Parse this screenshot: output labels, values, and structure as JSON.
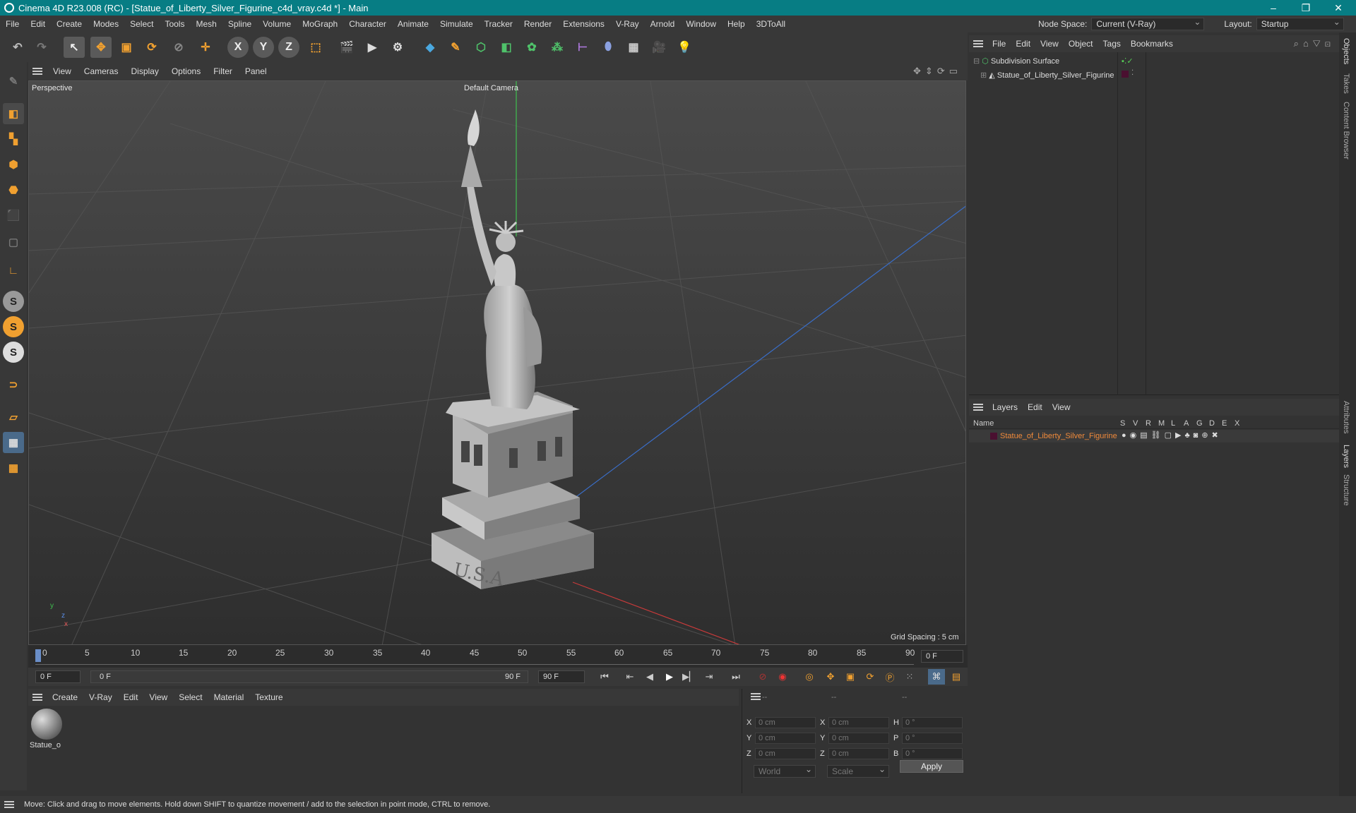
{
  "window": {
    "title": "Cinema 4D R23.008 (RC) - [Statue_of_Liberty_Silver_Figurine_c4d_vray.c4d *] - Main",
    "controls": [
      "–",
      "❐",
      "✕"
    ]
  },
  "menubar": {
    "items": [
      "File",
      "Edit",
      "Create",
      "Modes",
      "Select",
      "Tools",
      "Mesh",
      "Spline",
      "Volume",
      "MoGraph",
      "Character",
      "Animate",
      "Simulate",
      "Tracker",
      "Render",
      "Extensions",
      "V-Ray",
      "Arnold",
      "Window",
      "Help",
      "3DToAll"
    ],
    "node_space_label": "Node Space:",
    "node_space_value": "Current (V-Ray)",
    "layout_label": "Layout:",
    "layout_value": "Startup"
  },
  "toolbar": {
    "axis_x": "X",
    "axis_y": "Y",
    "axis_z": "Z"
  },
  "leftbar": {
    "s1": "S",
    "s2": "S",
    "s3": "S"
  },
  "viewport": {
    "menu": [
      "View",
      "Cameras",
      "Display",
      "Options",
      "Filter",
      "Panel"
    ],
    "label": "Perspective",
    "camera": "Default Camera",
    "grid_spacing": "Grid Spacing : 5 cm",
    "axis_y": "y",
    "axis_z": "z",
    "axis_x": "x"
  },
  "timeline": {
    "ticks": [
      "0",
      "5",
      "10",
      "15",
      "20",
      "25",
      "30",
      "35",
      "40",
      "45",
      "50",
      "55",
      "60",
      "65",
      "70",
      "75",
      "80",
      "85",
      "90"
    ],
    "current_frame": "0 F"
  },
  "transport": {
    "start": "0 F",
    "range_start": "0 F",
    "range_end": "90 F",
    "end": "90 F"
  },
  "material_manager": {
    "menu": [
      "Create",
      "V-Ray",
      "Edit",
      "View",
      "Select",
      "Material",
      "Texture"
    ],
    "material_name": "Statue_o"
  },
  "coordinates": {
    "headers": [
      "--",
      "--",
      "--"
    ],
    "rows": [
      {
        "a": "X",
        "av": "0 cm",
        "b": "X",
        "bv": "0 cm",
        "c": "H",
        "cv": "0 °"
      },
      {
        "a": "Y",
        "av": "0 cm",
        "b": "Y",
        "bv": "0 cm",
        "c": "P",
        "cv": "0 °"
      },
      {
        "a": "Z",
        "av": "0 cm",
        "b": "Z",
        "bv": "0 cm",
        "c": "B",
        "cv": "0 °"
      }
    ],
    "mode1": "World",
    "mode2": "Scale",
    "apply": "Apply"
  },
  "object_manager": {
    "menu": [
      "File",
      "Edit",
      "View",
      "Object",
      "Tags",
      "Bookmarks"
    ],
    "objects": [
      "Subdivision Surface",
      "Statue_of_Liberty_Silver_Figurine"
    ]
  },
  "layer_manager": {
    "menu": [
      "Layers",
      "Edit",
      "View"
    ],
    "col_name": "Name",
    "cols": [
      "S",
      "V",
      "R",
      "M",
      "L",
      "A",
      "G",
      "D",
      "E",
      "X"
    ],
    "layer": "Statue_of_Liberty_Silver_Figurine"
  },
  "side_tabs": [
    "Objects",
    "Takes",
    "Content Browser",
    "Attributes",
    "Layers",
    "Structure"
  ],
  "status": "Move: Click and drag to move elements. Hold down SHIFT to quantize movement / add to the selection in point mode, CTRL to remove.",
  "colors": {
    "titlebar": "#077d84",
    "accent": "#f0a030",
    "layer_text": "#f08a3a"
  }
}
